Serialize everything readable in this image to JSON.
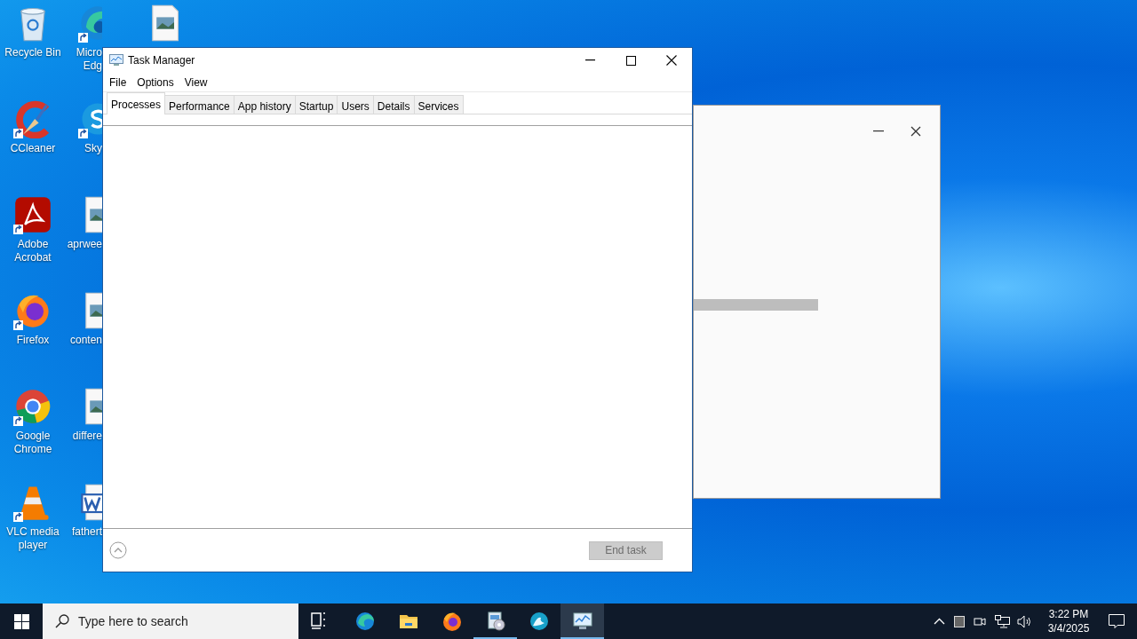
{
  "desktop": {
    "columns": [
      [
        {
          "kind": "recycle-bin",
          "shortcut": false,
          "lines": [
            "Recycle Bin"
          ]
        },
        {
          "kind": "ccleaner",
          "shortcut": true,
          "lines": [
            "CCleaner"
          ]
        },
        {
          "kind": "acrobat",
          "shortcut": true,
          "lines": [
            "Adobe",
            "Acrobat"
          ]
        },
        {
          "kind": "firefox",
          "shortcut": true,
          "lines": [
            "Firefox"
          ]
        },
        {
          "kind": "chrome",
          "shortcut": true,
          "lines": [
            "Google",
            "Chrome"
          ]
        },
        {
          "kind": "vlc",
          "shortcut": true,
          "lines": [
            "VLC media",
            "player"
          ]
        }
      ],
      [
        {
          "kind": "edge",
          "shortcut": true,
          "lines": [
            "Micro",
            "Edg"
          ]
        },
        {
          "kind": "skype",
          "shortcut": true,
          "lines": [
            "Sky"
          ]
        },
        {
          "kind": "image-file",
          "shortcut": false,
          "lines": [
            "aprwee"
          ]
        },
        {
          "kind": "image-file",
          "shortcut": false,
          "lines": [
            "conten"
          ]
        },
        {
          "kind": "image-file",
          "shortcut": false,
          "lines": [
            "differe"
          ]
        },
        {
          "kind": "word-file",
          "shortcut": false,
          "lines": [
            "fathert"
          ]
        }
      ],
      [
        {
          "kind": "image-file",
          "shortcut": false
        }
      ]
    ]
  },
  "task_manager": {
    "title": "Task Manager",
    "menu": [
      "File",
      "Options",
      "View"
    ],
    "tabs": [
      {
        "label": "Processes",
        "selected": true
      },
      {
        "label": "Performance",
        "selected": false
      },
      {
        "label": "App history",
        "selected": false
      },
      {
        "label": "Startup",
        "selected": false
      },
      {
        "label": "Users",
        "selected": false
      },
      {
        "label": "Details",
        "selected": false
      },
      {
        "label": "Services",
        "selected": false
      }
    ],
    "end_task": {
      "label": "End task",
      "disabled": true
    }
  },
  "taskbar": {
    "search_placeholder": "Type here to search",
    "apps": [
      {
        "kind": "task-view",
        "running": false,
        "selected": false
      },
      {
        "kind": "edge",
        "running": false,
        "selected": false
      },
      {
        "kind": "explorer",
        "running": false,
        "selected": false
      },
      {
        "kind": "firefox",
        "running": false,
        "selected": false
      },
      {
        "kind": "setup",
        "running": true,
        "selected": false
      },
      {
        "kind": "app-wave",
        "running": false,
        "selected": false
      },
      {
        "kind": "task-manager",
        "running": true,
        "selected": true
      }
    ],
    "time": "3:22 PM",
    "date": "3/4/2025"
  }
}
